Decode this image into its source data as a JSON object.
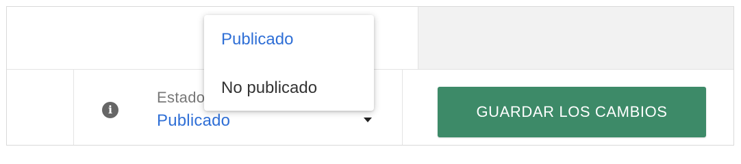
{
  "status_field": {
    "label": "Estado",
    "value": "Publicado",
    "info_icon": "info-icon",
    "caret_icon": "caret-down-icon"
  },
  "dropdown": {
    "options": [
      {
        "label": "Publicado",
        "selected": true
      },
      {
        "label": "No publicado",
        "selected": false
      }
    ]
  },
  "save_button": {
    "label": "GUARDAR LOS CAMBIOS"
  },
  "colors": {
    "accent_blue": "#2f6fd6",
    "button_green": "#3d8a68",
    "icon_gray": "#666666"
  }
}
